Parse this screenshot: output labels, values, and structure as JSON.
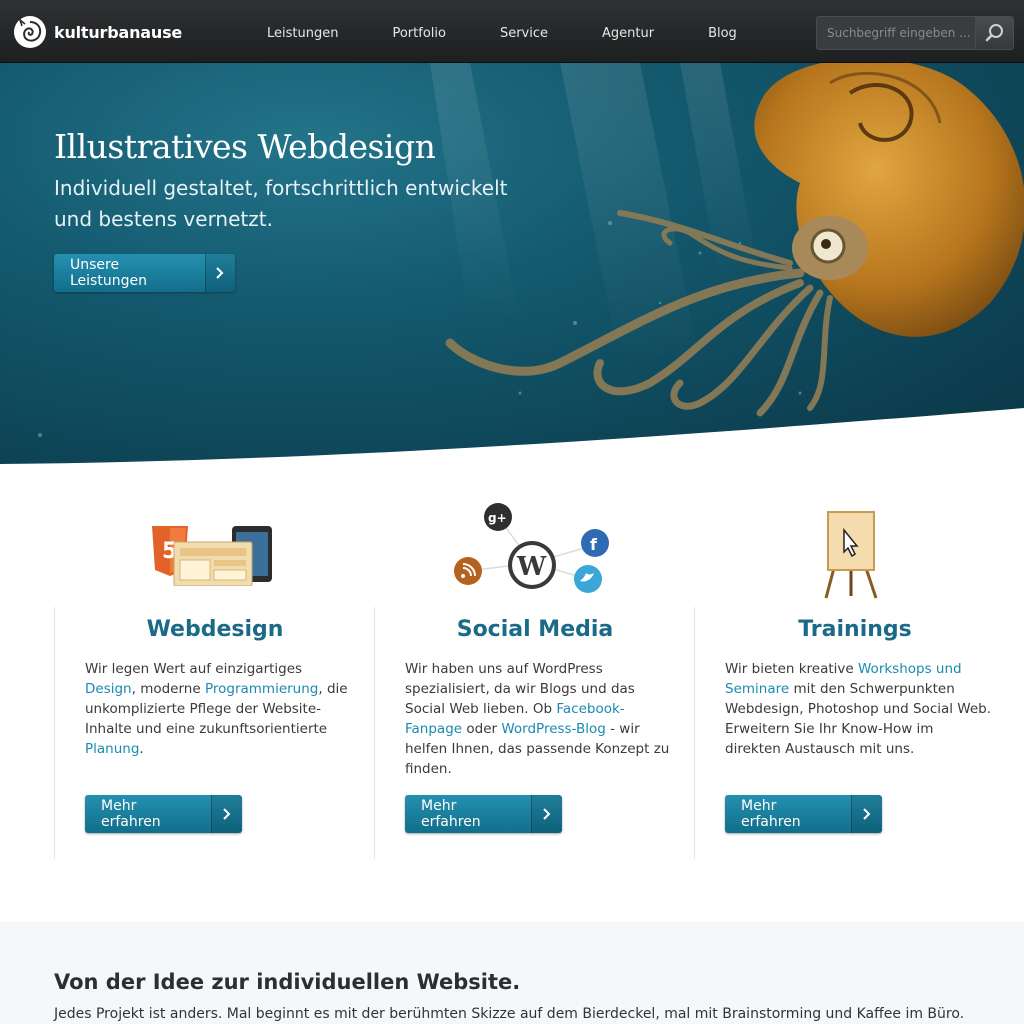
{
  "brand": {
    "name": "kulturbanause"
  },
  "nav": {
    "items": [
      "Leistungen",
      "Portfolio",
      "Service",
      "Agentur",
      "Blog"
    ]
  },
  "search": {
    "placeholder": "Suchbegriff eingeben ..."
  },
  "hero": {
    "title": "Illustratives Webdesign",
    "subtitle": "Individuell gestaltet, fortschrittlich entwickelt und bestens vernetzt.",
    "cta_label": "Unsere Leistungen"
  },
  "features": [
    {
      "title": "Webdesign",
      "text": [
        {
          "t": "Wir legen Wert auf einzigartiges ",
          "link": false
        },
        {
          "t": "Design",
          "link": true
        },
        {
          "t": ", moderne ",
          "link": false
        },
        {
          "t": "Programmierung",
          "link": true
        },
        {
          "t": ", die unkomplizierte Pflege der Website-Inhalte und eine zukunftsorientierte ",
          "link": false
        },
        {
          "t": "Planung",
          "link": true
        },
        {
          "t": ".",
          "link": false
        }
      ],
      "cta_label": "Mehr erfahren"
    },
    {
      "title": "Social Media",
      "text": [
        {
          "t": "Wir haben uns auf WordPress spezialisiert, da wir Blogs und das Social Web lieben. Ob ",
          "link": false
        },
        {
          "t": "Facebook-Fanpage",
          "link": true
        },
        {
          "t": " oder ",
          "link": false
        },
        {
          "t": "WordPress-Blog",
          "link": true
        },
        {
          "t": " - wir helfen Ihnen, das passende Konzept zu finden.",
          "link": false
        }
      ],
      "cta_label": "Mehr erfahren"
    },
    {
      "title": "Trainings",
      "text": [
        {
          "t": "Wir bieten kreative ",
          "link": false
        },
        {
          "t": "Workshops und Seminare",
          "link": true
        },
        {
          "t": " mit den Schwerpunkten Webdesign, Photoshop und Social Web. Erweitern Sie Ihr Know-How im direkten Austausch mit uns.",
          "link": false
        }
      ],
      "cta_label": "Mehr erfahren"
    }
  ],
  "lower": {
    "title": "Von der Idee zur individuellen Website.",
    "text": "Jedes Projekt ist anders. Mal beginnt es mit der berühmten Skizze auf dem Bierdeckel, mal mit Brainstorming und Kaffee im Büro."
  },
  "colors": {
    "accent": "#1b8ab1",
    "heading": "#1b6a87",
    "button": "#1a7fa0",
    "hero_sea": "#145a6f"
  }
}
